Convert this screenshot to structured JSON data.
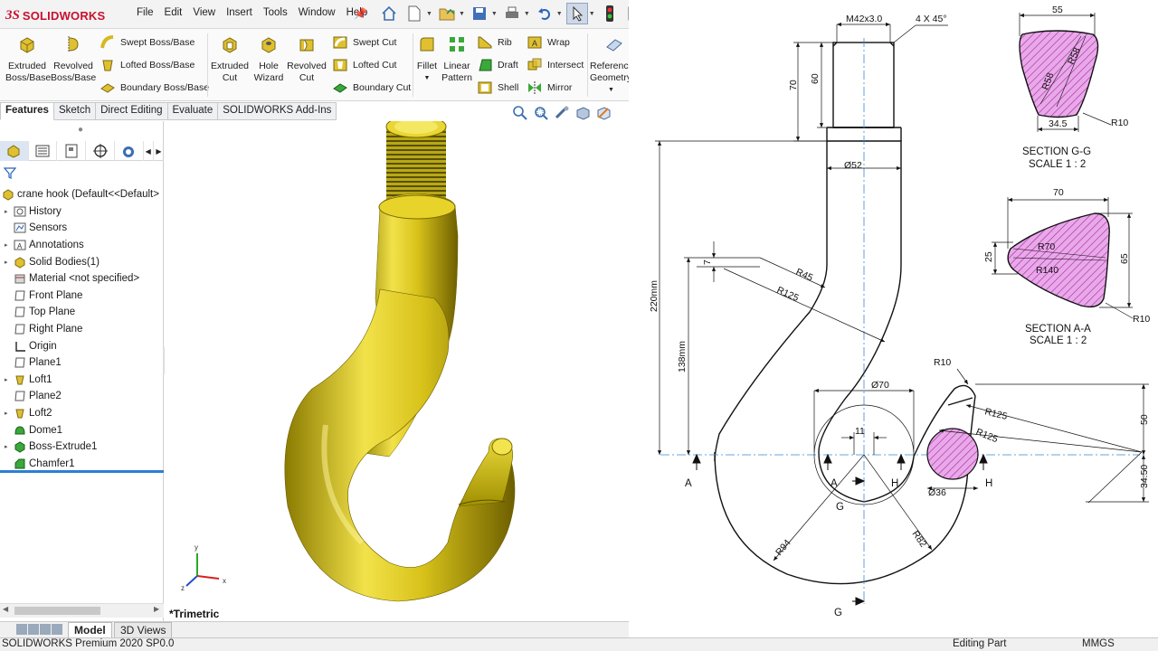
{
  "app": {
    "brand": "SOLIDWORKS",
    "logo_mark": "3S"
  },
  "menu": [
    "File",
    "Edit",
    "View",
    "Insert",
    "Tools",
    "Window",
    "Help"
  ],
  "command_manager": {
    "extruded_boss": [
      "Extruded",
      "Boss/Base"
    ],
    "revolved_boss": [
      "Revolved",
      "Boss/Base"
    ],
    "swept_boss": "Swept Boss/Base",
    "lofted_boss": "Lofted Boss/Base",
    "boundary_boss": "Boundary Boss/Base",
    "extruded_cut": [
      "Extruded",
      "Cut"
    ],
    "hole_wizard": [
      "Hole",
      "Wizard"
    ],
    "revolved_cut": [
      "Revolved",
      "Cut"
    ],
    "swept_cut": "Swept Cut",
    "lofted_cut": "Lofted Cut",
    "boundary_cut": "Boundary Cut",
    "fillet": "Fillet",
    "linear_pattern": [
      "Linear",
      "Pattern"
    ],
    "rib": "Rib",
    "draft": "Draft",
    "shell": "Shell",
    "wrap": "Wrap",
    "intersect": "Intersect",
    "mirror": "Mirror",
    "reference_geometry": [
      "Reference",
      "Geometry"
    ]
  },
  "tabs": [
    "Features",
    "Sketch",
    "Direct Editing",
    "Evaluate",
    "SOLIDWORKS Add-Ins"
  ],
  "feature_tree": {
    "root": "crane hook  (Default<<Default>",
    "items": [
      {
        "label": "History",
        "icon": "history-icon",
        "expandable": true
      },
      {
        "label": "Sensors",
        "icon": "sensors-icon",
        "expandable": false
      },
      {
        "label": "Annotations",
        "icon": "annotations-icon",
        "expandable": true
      },
      {
        "label": "Solid Bodies(1)",
        "icon": "solid-bodies-icon",
        "expandable": true
      },
      {
        "label": "Material <not specified>",
        "icon": "material-icon",
        "expandable": false
      },
      {
        "label": "Front Plane",
        "icon": "plane-icon",
        "expandable": false
      },
      {
        "label": "Top Plane",
        "icon": "plane-icon",
        "expandable": false
      },
      {
        "label": "Right Plane",
        "icon": "plane-icon",
        "expandable": false
      },
      {
        "label": "Origin",
        "icon": "origin-icon",
        "expandable": false
      },
      {
        "label": "Plane1",
        "icon": "plane-icon",
        "expandable": false
      },
      {
        "label": "Loft1",
        "icon": "loft-icon",
        "expandable": true
      },
      {
        "label": "Plane2",
        "icon": "plane-icon",
        "expandable": false
      },
      {
        "label": "Loft2",
        "icon": "loft-icon",
        "expandable": true
      },
      {
        "label": "Dome1",
        "icon": "dome-icon",
        "expandable": false
      },
      {
        "label": "Boss-Extrude1",
        "icon": "extrude-icon",
        "expandable": true
      },
      {
        "label": "Chamfer1",
        "icon": "chamfer-icon",
        "expandable": false
      }
    ]
  },
  "viewport": {
    "orientation": "*Trimetric",
    "triad": [
      "x",
      "y",
      "z"
    ]
  },
  "bottom_tabs": [
    "Model",
    "3D Views"
  ],
  "status": {
    "product": "SOLIDWORKS Premium 2020 SP0.0",
    "mode": "Editing Part",
    "units": "MMGS"
  },
  "drawing": {
    "thread": "M42x3.0",
    "chamfer": "4 X 45°",
    "dims": {
      "d70": "70",
      "d60": "60",
      "d220": "220mm",
      "d138": "138mm",
      "d7": "7",
      "r45": "R45",
      "r125a": "R125",
      "phi52": "Ø52",
      "phi70": "Ø70",
      "d11": "11",
      "r10": "R10",
      "r125b": "R125",
      "r125c": "R125",
      "d50": "50",
      "d3450": "34.50",
      "phi36": "Ø36",
      "r94": "R94",
      "r82": "R82"
    },
    "labels": {
      "a_left": "A",
      "a_mid": "A",
      "g_mid": "G",
      "g_bottom": "G",
      "h_left": "H",
      "h_right": "H"
    },
    "section_gg": {
      "title": "SECTION G-G",
      "scale": "SCALE 1 : 2",
      "w_top": "55",
      "w_bottom": "34.5",
      "r58a": "R58",
      "r58b": "R58",
      "r10": "R10"
    },
    "section_aa": {
      "title": "SECTION A-A",
      "scale": "SCALE 1 : 2",
      "w_top": "70",
      "h_right": "65",
      "h_left": "25",
      "r70": "R70",
      "r140": "R140",
      "r10": "R10"
    }
  },
  "colors": {
    "accent": "#2a7fd4",
    "section_fill": "#e69be6",
    "section_hatch": "#b030b0",
    "brand": "#c8102e",
    "hook": "#d8c21a"
  }
}
